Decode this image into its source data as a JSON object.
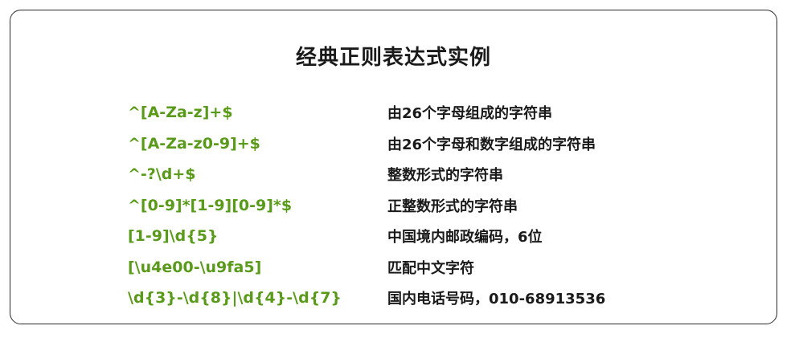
{
  "title": "经典正则表达式实例",
  "colors": {
    "pattern": "#5a9a1a",
    "text": "#1a1a1a",
    "border": "#2b2b2b"
  },
  "rows": [
    {
      "pattern": "^[A-Za-z]+$",
      "desc": "由26个字母组成的字符串"
    },
    {
      "pattern": "^[A-Za-z0-9]+$",
      "desc": "由26个字母和数字组成的字符串"
    },
    {
      "pattern": "^-?\\d+$",
      "desc": "整数形式的字符串"
    },
    {
      "pattern": "^[0-9]*[1-9][0-9]*$",
      "desc": "正整数形式的字符串"
    },
    {
      "pattern": "[1-9]\\d{5}",
      "desc": "中国境内邮政编码，6位"
    },
    {
      "pattern": "[\\u4e00-\\u9fa5]",
      "desc": "匹配中文字符"
    },
    {
      "pattern": "\\d{3}-\\d{8}|\\d{4}-\\d{7}",
      "desc": "国内电话号码，010-68913536"
    }
  ]
}
